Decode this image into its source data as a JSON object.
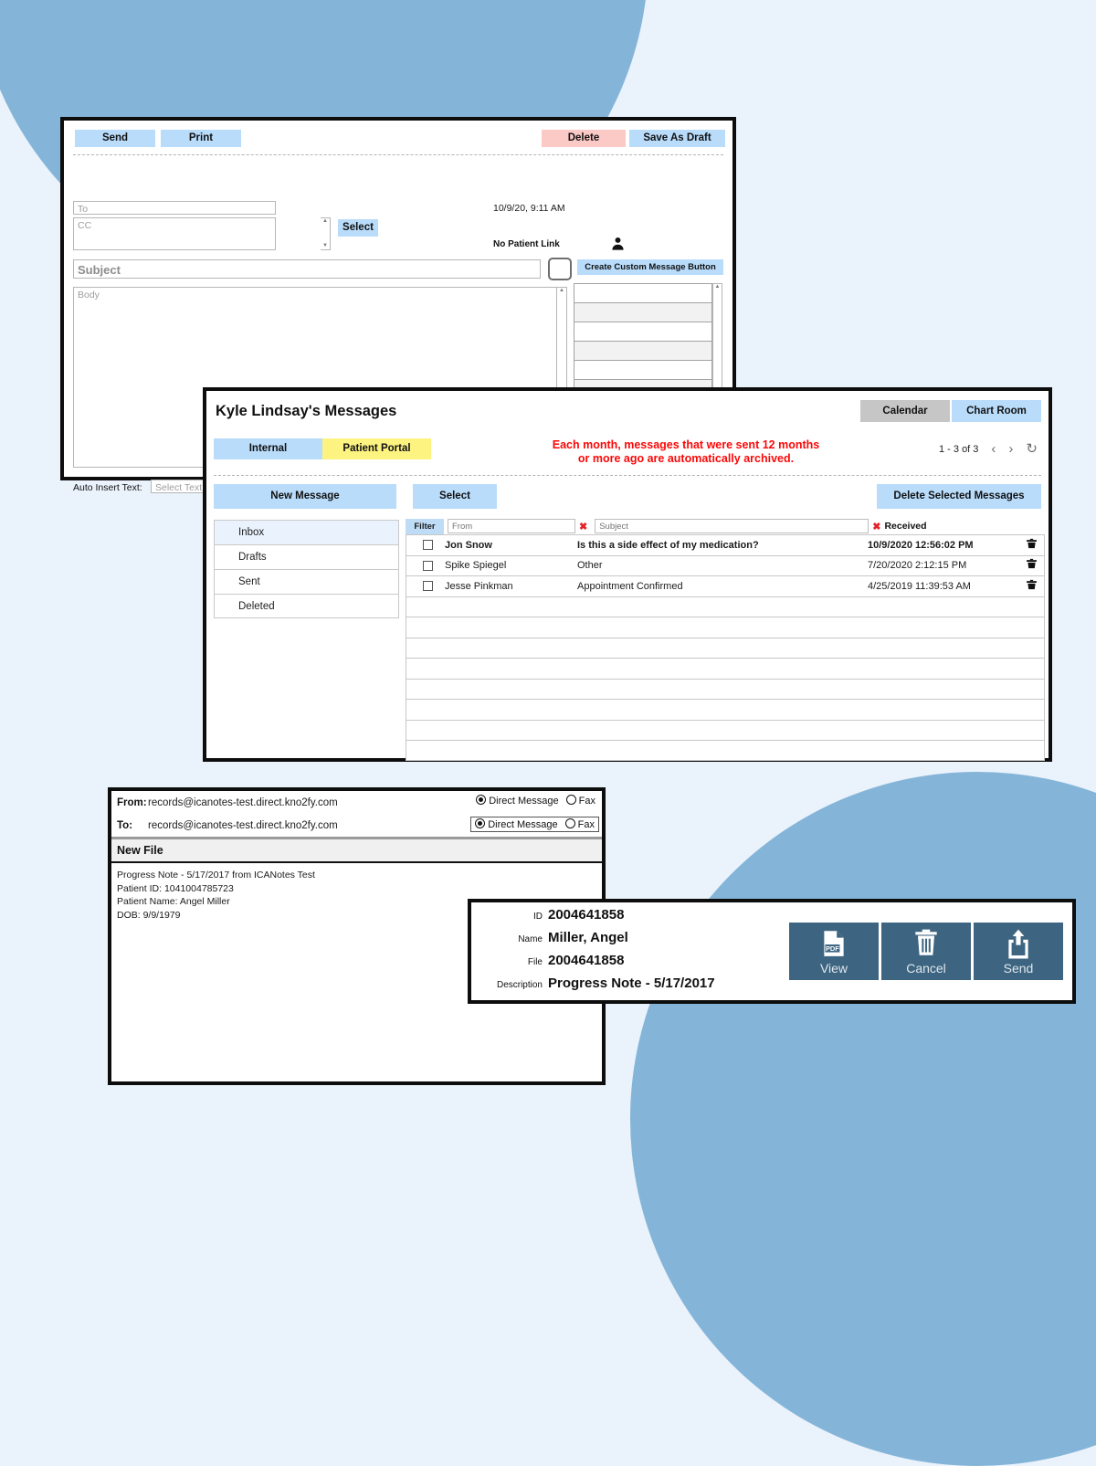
{
  "theme": {
    "accent_blue": "#b9dcfb",
    "circle_blue": "#84b5d9",
    "page_bg": "#eaf2fc",
    "danger_pink": "#fbc9c6",
    "notice_red": "#fb0808",
    "portal_yellow": "#fcf380",
    "dark_slate": "#3d6581"
  },
  "compose": {
    "toolbar": {
      "send_label": "Send",
      "print_label": "Print",
      "delete_label": "Delete",
      "save_draft_label": "Save As Draft"
    },
    "to_placeholder": "To",
    "cc_placeholder": "CC",
    "select_label": "Select",
    "date": "10/9/20, 9:11 AM",
    "patient_link": "No Patient Link",
    "subject_placeholder": "Subject",
    "create_custom_button": "Create Custom Message Button",
    "body_placeholder": "Body",
    "auto_insert_label": "Auto Insert Text:",
    "auto_insert_placeholder": "Select Text",
    "custom_rows": [
      "",
      "",
      "",
      "",
      "",
      "",
      "",
      "",
      ""
    ]
  },
  "messages": {
    "title": "Kyle Lindsay's Messages",
    "calendar_label": "Calendar",
    "chart_room_label": "Chart Room",
    "tabs": [
      {
        "label": "Internal",
        "active": true
      },
      {
        "label": "Patient Portal",
        "active": false
      }
    ],
    "notice_line1": "Each month, messages that were sent 12 months",
    "notice_line2": "or more ago are automatically archived.",
    "pager": {
      "range": "1 - 3 of 3",
      "prev_icon": "chevron-left-icon",
      "next_icon": "chevron-right-icon",
      "refresh_icon": "refresh-icon"
    },
    "new_message_label": "New Message",
    "select_label": "Select",
    "delete_selected_label": "Delete Selected Messages",
    "folders": [
      {
        "label": "Inbox",
        "active": true
      },
      {
        "label": "Drafts",
        "active": false
      },
      {
        "label": "Sent",
        "active": false
      },
      {
        "label": "Deleted",
        "active": false
      }
    ],
    "filter": {
      "label": "Filter",
      "from_placeholder": "From",
      "subject_placeholder": "Subject",
      "received_label": "Received"
    },
    "rows": [
      {
        "from": "Jon Snow",
        "subject": "Is this a side effect of my medication?",
        "received": "10/9/2020 12:56:02 PM",
        "unread": true
      },
      {
        "from": "Spike Spiegel",
        "subject": "Other",
        "received": "7/20/2020 2:12:15 PM",
        "unread": false
      },
      {
        "from": "Jesse Pinkman",
        "subject": "Appointment Confirmed",
        "received": "4/25/2019 11:39:53 AM",
        "unread": false
      }
    ],
    "empty_row_count": 8
  },
  "direct_message": {
    "from_label": "From:",
    "from_value": "records@icanotes-test.direct.kno2fy.com",
    "to_label": "To:",
    "to_value": "records@icanotes-test.direct.kno2fy.com",
    "option_direct": "Direct Message",
    "option_fax": "Fax",
    "new_file_label": "New File",
    "content_lines": [
      "Progress Note - 5/17/2017 from ICANotes Test",
      "Patient ID: 1041004785723",
      "Patient Name: Angel Miller",
      "DOB: 9/9/1979"
    ]
  },
  "file_detail": {
    "fields": [
      {
        "label": "ID",
        "value": "2004641858"
      },
      {
        "label": "Name",
        "value": "Miller, Angel"
      },
      {
        "label": "File",
        "value": "2004641858"
      },
      {
        "label": "Description",
        "value": "Progress Note - 5/17/2017"
      }
    ],
    "buttons": [
      {
        "label": "View",
        "icon": "pdf-document-icon"
      },
      {
        "label": "Cancel",
        "icon": "trash-icon"
      },
      {
        "label": "Send",
        "icon": "upload-icon"
      }
    ]
  }
}
